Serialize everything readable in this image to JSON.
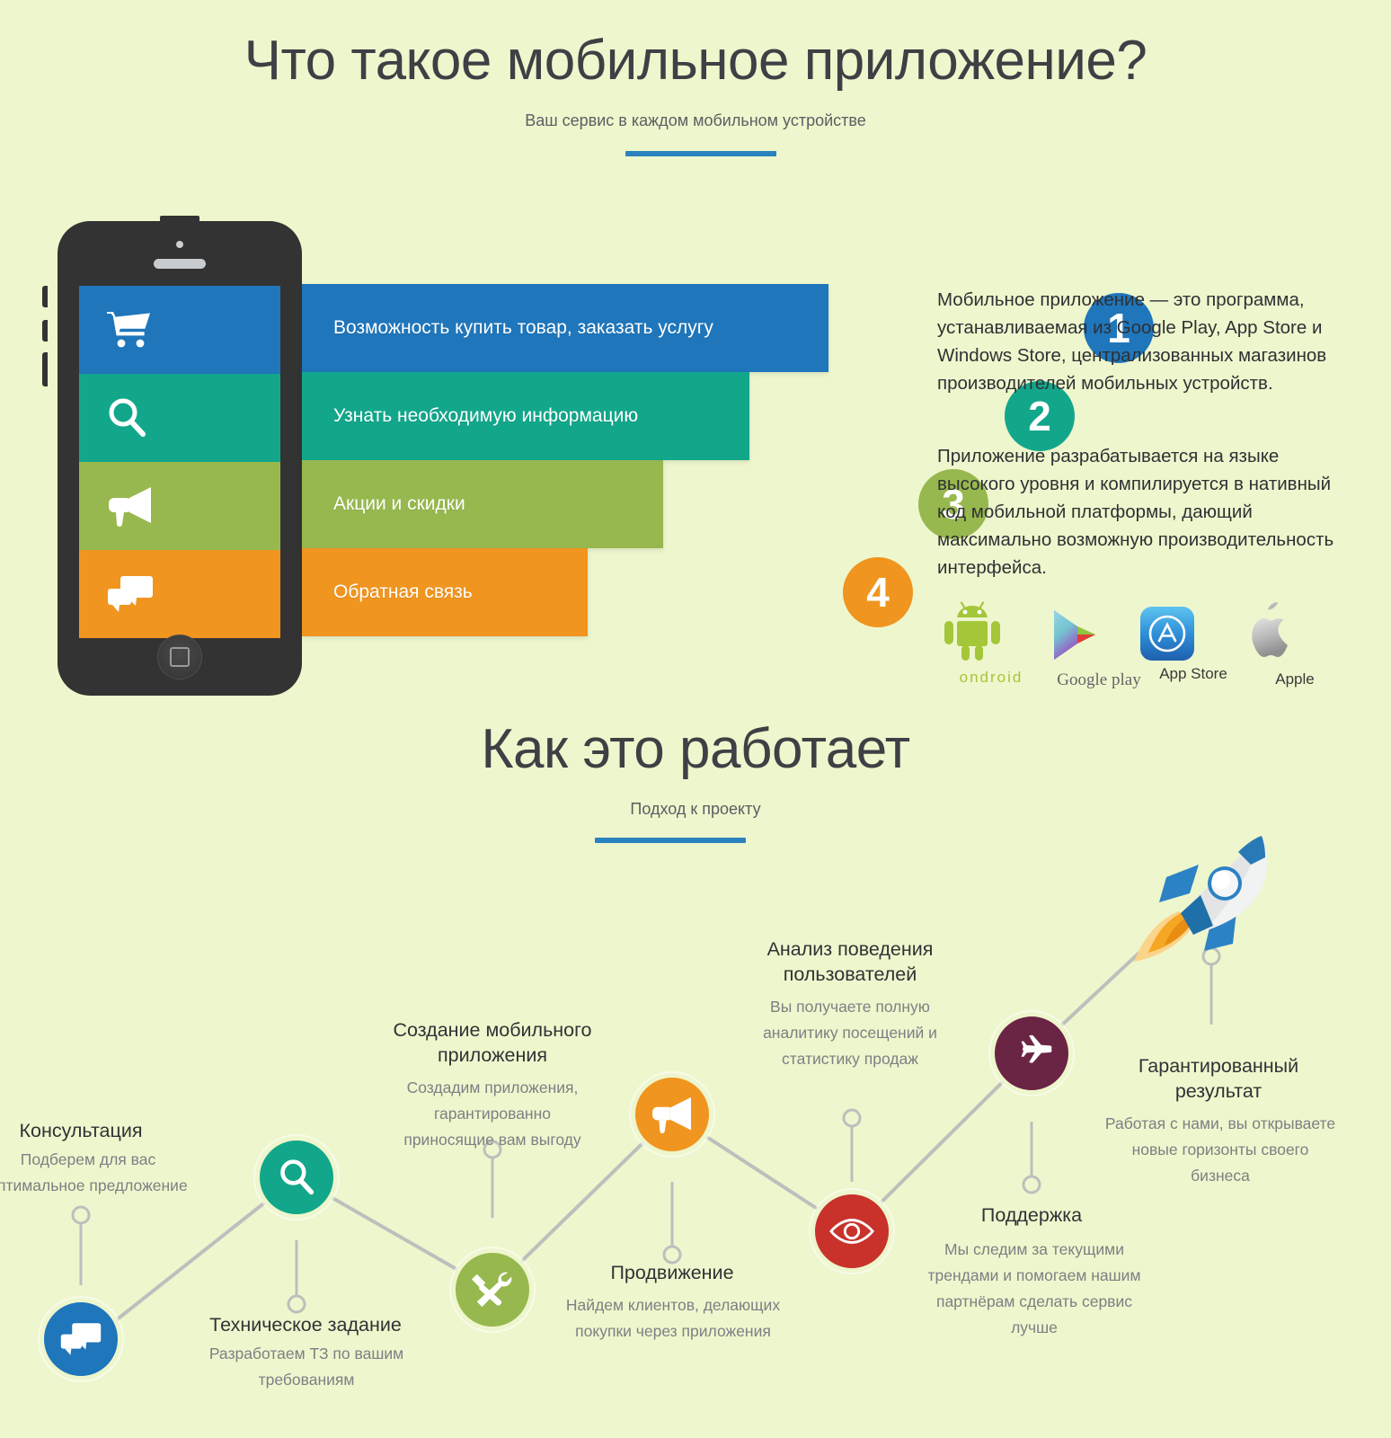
{
  "background_color": "#eef6cd",
  "accent_color": "#2a82be",
  "section_one": {
    "title": "Что такое мобильное приложение?",
    "subtitle": "Ваш сервис в каждом мобильном устройстве"
  },
  "phone": {
    "home_button_icon": "home-square-icon",
    "screen_icons": [
      "shopping-cart-icon",
      "search-icon",
      "megaphone-icon",
      "chat-bubbles-icon"
    ]
  },
  "features": [
    {
      "number": "1",
      "label": "Возможность купить товар, заказать услугу",
      "color": "#1f76bb",
      "icon": "shopping-cart-icon"
    },
    {
      "number": "2",
      "label": "Узнать необходимую информацию",
      "color": "#12a78b",
      "icon": "search-icon"
    },
    {
      "number": "3",
      "label": "Акции и скидки",
      "color": "#97b84e",
      "icon": "megaphone-icon"
    },
    {
      "number": "4",
      "label": "Обратная связь",
      "color": "#f0951f",
      "icon": "chat-bubbles-icon"
    }
  ],
  "description": {
    "paragraph_1": "Мобильное приложение — это программа, устанавливаемая из Google Play, App Store и Windows Store, централизованных магазинов производителей мобильных устройств.",
    "paragraph_2": "Приложение разрабатывается на языке высокого уровня и компилируется в нативный код мобильной платформы, дающий максимально возможную производительность интерфейса."
  },
  "stores": [
    {
      "caption": "ondroid",
      "icon": "android-robot-icon"
    },
    {
      "caption": "Google play",
      "icon": "google-play-icon"
    },
    {
      "caption": "App Store",
      "icon": "app-store-icon"
    },
    {
      "caption": "Apple",
      "icon": "apple-logo-icon"
    }
  ],
  "section_two": {
    "title": "Как это работает",
    "subtitle": "Подход к проекту"
  },
  "roadmap": {
    "rocket_icon": "rocket-icon",
    "steps": [
      {
        "title": "Консультация",
        "desc": "Подберем для вас\nоптимальное предложение",
        "icon": "chat-bubbles-icon",
        "color": "#1f76bb"
      },
      {
        "title": "Техническое задание",
        "desc": "Разработаем ТЗ по вашим\nтребованиям",
        "icon": "search-icon",
        "color": "#12a78b"
      },
      {
        "title": "Создание мобильного\nприложения",
        "desc": "Создадим приложения,\nгарантированно\nприносящие вам выгоду",
        "icon": "tools-icon",
        "color": "#97b84e"
      },
      {
        "title": "Продвижение",
        "desc": "Найдем  клиентов, делающих\nпокупки через приложения",
        "icon": "megaphone-icon",
        "color": "#f0951f"
      },
      {
        "title": "Анализ  поведения\nпользователей",
        "desc": "Вы получаете полную\nаналитику посещений и\nстатистику продаж",
        "icon": "eye-icon",
        "color": "#c8322b"
      },
      {
        "title": "Поддержка",
        "desc": "Мы следим за текущими\nтрендами и помогаем нашим\nпартнёрам сделать сервис\nлучше",
        "icon": "airplane-icon",
        "color": "#6b2544"
      },
      {
        "title": "Гарантированный\nрезультат",
        "desc": "Работая с нами, вы открываете\nновые горизонты своего\nбизнеса",
        "icon": "",
        "color": ""
      }
    ]
  }
}
